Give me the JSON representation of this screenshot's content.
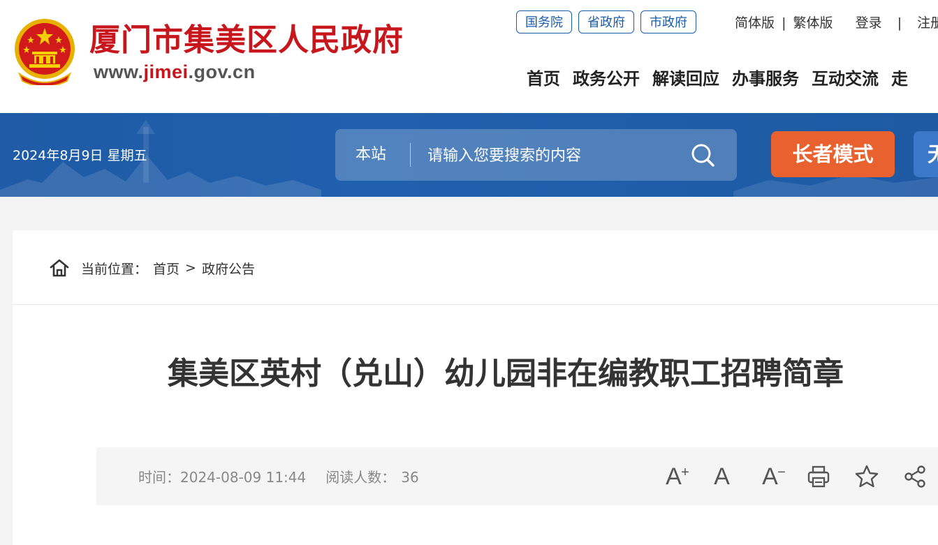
{
  "header": {
    "site_name": "厦门市集美区人民政府",
    "site_url_prefix": "www.",
    "site_url_highlight": "jimei",
    "site_url_suffix": ".gov.cn",
    "gov_links": [
      "国务院",
      "省政府",
      "市政府"
    ],
    "lang_simplified": "简体版",
    "lang_separator": "|",
    "lang_traditional": "繁体版",
    "login": "登录",
    "auth_separator": "|",
    "register": "注册",
    "nav": [
      "首页",
      "政务公开",
      "解读回应",
      "办事服务",
      "互动交流",
      "走"
    ]
  },
  "banner": {
    "date": "2024年8月9日 星期五",
    "search_scope": "本站",
    "search_placeholder": "请输入您要搜索的内容",
    "elder_mode": "长者模式",
    "accessibility_partial": "无"
  },
  "breadcrumb": {
    "label": "当前位置：",
    "items": [
      "首页",
      "政府公告"
    ],
    "separator": ">"
  },
  "article": {
    "title": "集美区英村（兑山）幼儿园非在编教职工招聘简章",
    "time_label": "时间：",
    "time_value": "2024-08-09 11:44",
    "reads_label": "阅读人数：",
    "reads_value": "36"
  },
  "tools": {
    "font_increase": "A",
    "font_increase_mark": "+",
    "font_normal": "A",
    "font_decrease": "A",
    "font_decrease_mark": "−"
  },
  "colors": {
    "brand_red": "#c8161d",
    "banner_blue": "#1f5ba6",
    "elder_orange": "#e8612e",
    "link_blue": "#1a5ca8"
  },
  "icons": [
    "emblem-icon",
    "search-icon",
    "home-icon",
    "print-icon",
    "star-icon",
    "share-icon"
  ]
}
